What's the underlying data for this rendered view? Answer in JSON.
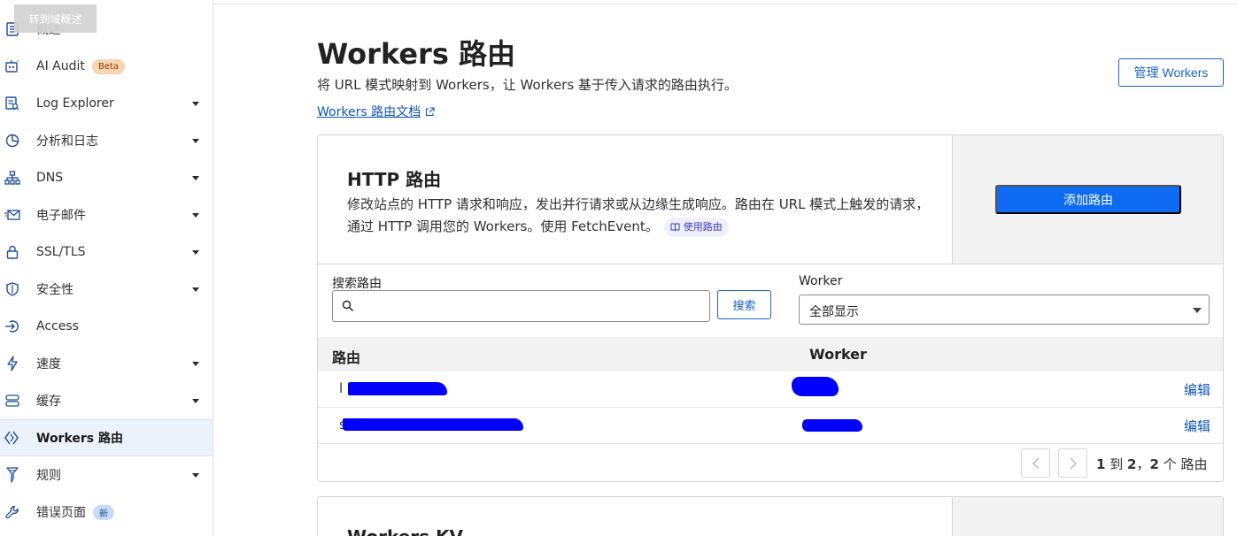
{
  "tooltip": "转到域概述",
  "sidebar": {
    "items": [
      {
        "label": "概述",
        "icon": "document-icon"
      },
      {
        "label": "AI Audit",
        "icon": "robot-icon",
        "badge": "Beta"
      },
      {
        "label": "Log Explorer",
        "icon": "log-explorer-icon"
      },
      {
        "label": "分析和日志",
        "icon": "chart-pie-icon"
      },
      {
        "label": "DNS",
        "icon": "network-icon"
      },
      {
        "label": "电子邮件",
        "icon": "email-icon"
      },
      {
        "label": "SSL/TLS",
        "icon": "lock-icon"
      },
      {
        "label": "安全性",
        "icon": "shield-icon"
      },
      {
        "label": "Access",
        "icon": "access-icon"
      },
      {
        "label": "速度",
        "icon": "bolt-icon"
      },
      {
        "label": "缓存",
        "icon": "database-icon"
      },
      {
        "label": "Workers 路由",
        "icon": "workers-icon"
      },
      {
        "label": "规则",
        "icon": "rules-icon"
      },
      {
        "label": "错误页面",
        "icon": "wrench-icon",
        "badge": "新"
      }
    ]
  },
  "header": {
    "title": "Workers 路由",
    "subtitle": "将 URL 模式映射到 Workers，让 Workers 基于传入请求的路由执行。",
    "doc_link": "Workers 路由文档",
    "manage_button": "管理 Workers"
  },
  "http_routes": {
    "title": "HTTP 路由",
    "description": "修改站点的 HTTP 请求和响应，发出并行请求或从边缘生成响应。路由在 URL 模式上触发的请求，通过 HTTP 调用您的 Workers。使用 FetchEvent。",
    "use_route_chip": "使用路由",
    "add_button": "添加路由",
    "search_label": "搜索路由",
    "search_placeholder": "",
    "search_button": "搜索",
    "worker_label": "Worker",
    "worker_select_value": "全部显示",
    "columns": [
      "路由",
      "Worker"
    ],
    "rows": [
      {
        "route": "l",
        "worker": "",
        "action": "编辑"
      },
      {
        "route": "s",
        "worker": "",
        "action": "编辑"
      }
    ],
    "pagination": {
      "from": "1",
      "to_word": "到",
      "to": "2",
      "total": "2",
      "unit": "个 路由"
    }
  },
  "kv": {
    "title": "Workers KV"
  },
  "colors": {
    "accent": "#0d6cf2",
    "link": "#0b55b8",
    "redaction": "#0000ff"
  }
}
